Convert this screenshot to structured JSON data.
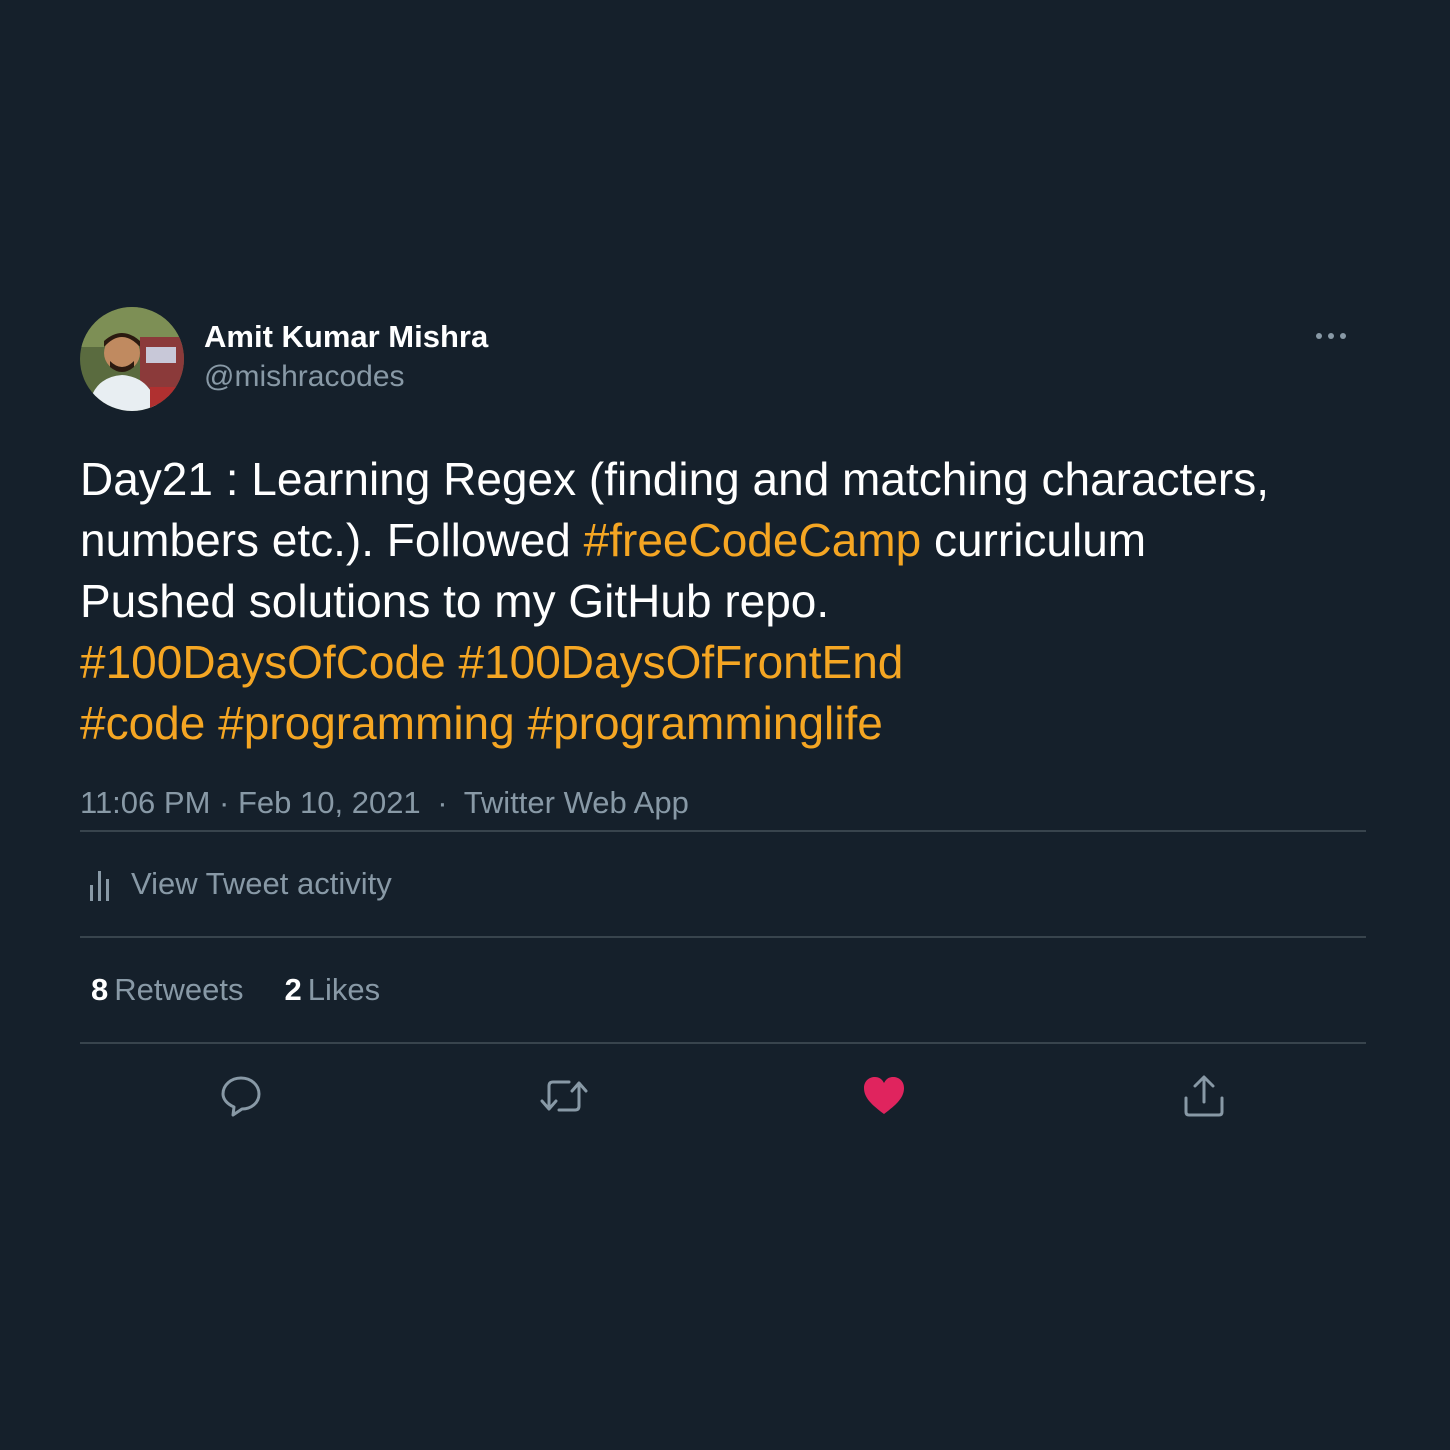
{
  "author": {
    "name": "Amit Kumar Mishra",
    "handle": "@mishracodes",
    "avatar_icon": "profile-photo"
  },
  "tweet": {
    "lines": [
      [
        {
          "text": "Day21 : Learning Regex (finding and matching characters,",
          "hashtag": false
        }
      ],
      [
        {
          "text": "numbers etc.). Followed ",
          "hashtag": false
        },
        {
          "text": "#freeCodeCamp",
          "hashtag": true
        },
        {
          "text": " curriculum",
          "hashtag": false
        }
      ],
      [
        {
          "text": "Pushed solutions to my GitHub repo.",
          "hashtag": false
        }
      ],
      [
        {
          "text": "#100DaysOfCode",
          "hashtag": true
        },
        {
          "text": " ",
          "hashtag": false
        },
        {
          "text": "#100DaysOfFrontEnd",
          "hashtag": true
        }
      ],
      [
        {
          "text": "#code",
          "hashtag": true
        },
        {
          "text": " ",
          "hashtag": false
        },
        {
          "text": "#programming",
          "hashtag": true
        },
        {
          "text": " ",
          "hashtag": false
        },
        {
          "text": "#programminglife",
          "hashtag": true
        }
      ]
    ],
    "time": "11:06 PM",
    "date": "Feb 10, 2021",
    "source": "Twitter Web App",
    "separator": "·"
  },
  "activity": {
    "label": "View Tweet activity",
    "icon": "bar-chart-icon"
  },
  "stats": {
    "retweets_count": "8",
    "retweets_label": "Retweets",
    "likes_count": "2",
    "likes_label": "Likes"
  },
  "actions": {
    "icons": [
      "reply-icon",
      "retweet-icon",
      "like-icon",
      "share-icon"
    ],
    "liked": true
  },
  "colors": {
    "background": "#15202b",
    "hashtag": "#f5a623",
    "secondary_text": "#8899a6",
    "divider": "#38444d",
    "like": "#e0245e"
  }
}
